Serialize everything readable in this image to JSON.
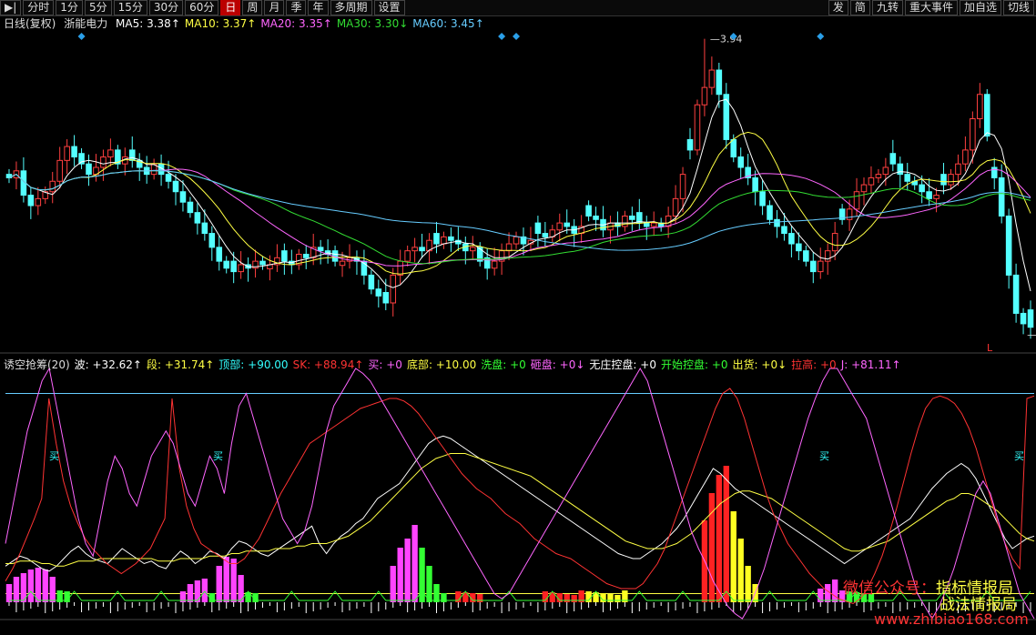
{
  "toolbar": {
    "left": [
      "分时",
      "1分",
      "5分",
      "15分",
      "30分",
      "60分",
      "日",
      "周",
      "月",
      "季",
      "年",
      "多周期",
      "设置"
    ],
    "active": "日",
    "right": [
      "发",
      "简",
      "九转",
      "重大事件",
      "加自选",
      "切线"
    ]
  },
  "main_header": {
    "period": "日线(复权)",
    "name": "浙能电力",
    "ma": [
      {
        "label": "MA5: 3.38↑",
        "color": "#ffffff"
      },
      {
        "label": "MA10: 3.37↑",
        "color": "#ffff44"
      },
      {
        "label": "MA20: 3.35↑",
        "color": "#ff66ff"
      },
      {
        "label": "MA30: 3.30↓",
        "color": "#33dd33"
      },
      {
        "label": "MA60: 3.45↑",
        "color": "#66ccff"
      }
    ]
  },
  "price_labels": {
    "high": "3.94",
    "low": "3.09",
    "marker": "L"
  },
  "indicator_header": [
    {
      "label": "诱空抢筹(20)",
      "color": "#dddddd"
    },
    {
      "label": "波: +32.62↑",
      "color": "#ffffff"
    },
    {
      "label": "段: +31.74↑",
      "color": "#ffff44"
    },
    {
      "label": "顶部: +90.00",
      "color": "#33ffff"
    },
    {
      "label": "SK: +88.94↑",
      "color": "#ff3333"
    },
    {
      "label": "买: +0",
      "color": "#ff66ff"
    },
    {
      "label": "底部: +10.00",
      "color": "#ffff44"
    },
    {
      "label": "洗盘: +0",
      "color": "#33ff33"
    },
    {
      "label": "砸盘: +0↓",
      "color": "#ff66ff"
    },
    {
      "label": "无庄控盘: +0",
      "color": "#ffffff"
    },
    {
      "label": "开始控盘: +0",
      "color": "#33ff33"
    },
    {
      "label": "出货: +0↓",
      "color": "#ffff44"
    },
    {
      "label": "拉高: +0",
      "color": "#ff3333"
    },
    {
      "label": "J: +81.11↑",
      "color": "#ff66ff"
    }
  ],
  "buy_label": "买",
  "watermark": {
    "l1a": "微信公众号：",
    "l1b": "指标情报局",
    "l2": "战法情报局",
    "url": "www.zhibiao168.com"
  },
  "chart_data": {
    "type": "candlestick",
    "symbol": "浙能电力",
    "period": "日线(复权)",
    "ylim": [
      3.09,
      3.94
    ],
    "high": 3.94,
    "low": 3.09,
    "close": [
      3.54,
      3.56,
      3.49,
      3.46,
      3.48,
      3.5,
      3.53,
      3.59,
      3.63,
      3.6,
      3.58,
      3.55,
      3.57,
      3.6,
      3.62,
      3.58,
      3.6,
      3.59,
      3.57,
      3.55,
      3.58,
      3.55,
      3.53,
      3.5,
      3.47,
      3.44,
      3.41,
      3.38,
      3.34,
      3.3,
      3.28,
      3.27,
      3.29,
      3.28,
      3.3,
      3.29,
      3.29,
      3.31,
      3.3,
      3.29,
      3.32,
      3.31,
      3.34,
      3.33,
      3.32,
      3.3,
      3.3,
      3.31,
      3.3,
      3.26,
      3.22,
      3.2,
      3.18,
      3.26,
      3.3,
      3.33,
      3.34,
      3.33,
      3.36,
      3.35,
      3.37,
      3.36,
      3.35,
      3.33,
      3.34,
      3.3,
      3.28,
      3.3,
      3.33,
      3.35,
      3.37,
      3.35,
      3.36,
      3.38,
      3.37,
      3.39,
      3.41,
      3.4,
      3.38,
      3.4,
      3.43,
      3.42,
      3.39,
      3.41,
      3.4,
      3.43,
      3.42,
      3.41,
      3.4,
      3.41,
      3.4,
      3.43,
      3.48,
      3.55,
      3.62,
      3.75,
      3.8,
      3.85,
      3.78,
      3.65,
      3.6,
      3.57,
      3.54,
      3.5,
      3.46,
      3.42,
      3.4,
      3.38,
      3.35,
      3.33,
      3.3,
      3.27,
      3.3,
      3.33,
      3.38,
      3.42,
      3.45,
      3.5,
      3.52,
      3.54,
      3.55,
      3.57,
      3.58,
      3.55,
      3.53,
      3.52,
      3.5,
      3.48,
      3.49,
      3.52,
      3.55,
      3.58,
      3.62,
      3.71,
      3.78,
      3.66,
      3.54,
      3.43,
      3.26,
      3.15,
      3.12,
      3.11
    ]
  },
  "indicator_data": {
    "series": [
      {
        "name": "波",
        "color": "#ffffff",
        "values": [
          21,
          23,
          25,
          24,
          22,
          20,
          19,
          21,
          24,
          27,
          29,
          26,
          24,
          23,
          22,
          25,
          28,
          26,
          24,
          22,
          23,
          21,
          20,
          24,
          27,
          25,
          22,
          24,
          27,
          26,
          24,
          28,
          31,
          30,
          28,
          26,
          25,
          27,
          29,
          31,
          33,
          35,
          37,
          30,
          26,
          30,
          33,
          35,
          38,
          40,
          44,
          48,
          50,
          52,
          54,
          58,
          62,
          66,
          70,
          72,
          73,
          72,
          70,
          68,
          66,
          64,
          62,
          60,
          58,
          56,
          54,
          52,
          50,
          48,
          46,
          44,
          42,
          40,
          38,
          36,
          34,
          32,
          30,
          28,
          26,
          25,
          24,
          24,
          26,
          28,
          30,
          33,
          36,
          40,
          45,
          50,
          55,
          60,
          58,
          55,
          52,
          50,
          48,
          46,
          44,
          42,
          40,
          38,
          36,
          34,
          32,
          30,
          28,
          26,
          24,
          22,
          24,
          26,
          28,
          30,
          32,
          34,
          36,
          38,
          40,
          44,
          48,
          52,
          55,
          58,
          60,
          62,
          60,
          56,
          50,
          44,
          38,
          32,
          28,
          30,
          32,
          33
        ]
      },
      {
        "name": "段",
        "color": "#ffff44",
        "values": [
          22,
          22,
          23,
          23,
          23,
          22,
          22,
          21,
          21,
          22,
          23,
          23,
          23,
          24,
          24,
          24,
          24,
          24,
          24,
          24,
          24,
          23,
          23,
          23,
          24,
          24,
          24,
          24,
          25,
          25,
          25,
          26,
          26,
          27,
          27,
          27,
          27,
          28,
          28,
          28,
          29,
          29,
          30,
          30,
          30,
          31,
          32,
          33,
          35,
          37,
          39,
          42,
          45,
          48,
          51,
          54,
          57,
          60,
          62,
          64,
          65,
          66,
          66,
          66,
          65,
          64,
          63,
          62,
          61,
          60,
          59,
          58,
          57,
          55,
          53,
          51,
          49,
          47,
          45,
          43,
          41,
          39,
          37,
          35,
          33,
          31,
          30,
          29,
          28,
          28,
          28,
          29,
          30,
          32,
          34,
          37,
          40,
          43,
          46,
          48,
          50,
          51,
          51,
          50,
          49,
          48,
          46,
          44,
          42,
          40,
          38,
          36,
          34,
          32,
          30,
          28,
          27,
          27,
          28,
          29,
          30,
          31,
          33,
          35,
          37,
          39,
          41,
          43,
          45,
          47,
          48,
          50,
          50,
          49,
          47,
          45,
          43,
          40,
          37,
          34,
          32,
          31
        ]
      },
      {
        "name": "SK",
        "color": "#ff3333",
        "values": [
          15,
          20,
          26,
          33,
          40,
          48,
          88,
          70,
          55,
          45,
          38,
          32,
          28,
          25,
          22,
          20,
          18,
          20,
          22,
          25,
          28,
          34,
          40,
          88,
          60,
          45,
          36,
          30,
          28,
          26,
          24,
          22,
          22,
          24,
          28,
          32,
          38,
          44,
          50,
          55,
          60,
          65,
          70,
          72,
          74,
          76,
          78,
          80,
          82,
          84,
          85,
          86,
          87,
          88,
          88,
          87,
          85,
          82,
          78,
          74,
          70,
          66,
          62,
          58,
          55,
          52,
          50,
          48,
          45,
          42,
          40,
          38,
          35,
          32,
          30,
          28,
          26,
          25,
          24,
          22,
          20,
          18,
          16,
          14,
          13,
          12,
          12,
          12,
          14,
          18,
          22,
          28,
          36,
          44,
          52,
          60,
          68,
          76,
          84,
          90,
          92,
          88,
          80,
          70,
          60,
          50,
          42,
          36,
          30,
          26,
          22,
          18,
          15,
          12,
          10,
          8,
          7,
          6,
          8,
          12,
          18,
          25,
          34,
          44,
          55,
          66,
          76,
          84,
          88,
          89,
          88,
          86,
          82,
          76,
          68,
          58,
          48,
          38,
          30,
          24,
          20,
          88,
          89
        ]
      },
      {
        "name": "J",
        "color": "#ff66ff",
        "values": [
          30,
          45,
          60,
          75,
          85,
          95,
          100,
          85,
          70,
          55,
          40,
          30,
          25,
          40,
          55,
          65,
          60,
          50,
          45,
          55,
          65,
          70,
          75,
          70,
          60,
          50,
          45,
          55,
          65,
          60,
          50,
          70,
          85,
          90,
          80,
          70,
          60,
          50,
          40,
          35,
          30,
          35,
          45,
          60,
          75,
          85,
          90,
          95,
          100,
          98,
          95,
          90,
          85,
          80,
          75,
          70,
          65,
          60,
          55,
          50,
          45,
          40,
          35,
          30,
          25,
          20,
          15,
          10,
          8,
          10,
          15,
          20,
          25,
          30,
          35,
          40,
          45,
          50,
          55,
          60,
          65,
          70,
          75,
          80,
          85,
          90,
          95,
          100,
          95,
          85,
          75,
          65,
          55,
          45,
          35,
          28,
          22,
          15,
          10,
          5,
          2,
          0,
          5,
          12,
          20,
          30,
          40,
          50,
          60,
          70,
          80,
          88,
          95,
          100,
          100,
          95,
          90,
          85,
          80,
          70,
          60,
          50,
          40,
          30,
          20,
          10,
          5,
          0,
          5,
          12,
          20,
          30,
          40,
          50,
          55,
          50,
          40,
          30,
          20,
          10,
          5,
          0
        ]
      }
    ],
    "top_level": 90,
    "bottom_level": 10
  }
}
